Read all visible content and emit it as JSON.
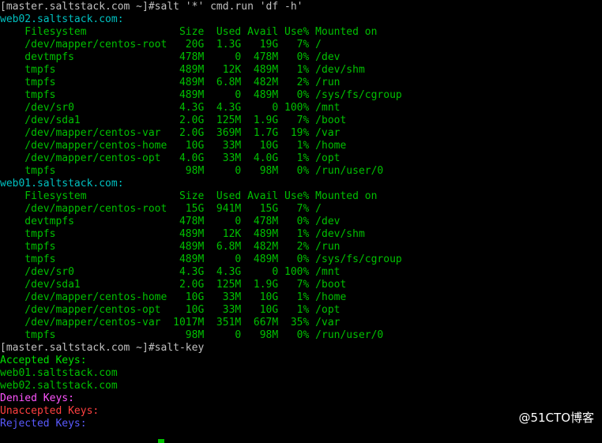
{
  "colors": {
    "background": "#000000",
    "prompt": "#c0c0c0",
    "output": "#00c000",
    "minion_id": "#00c0c0",
    "accepted_header": "#00e000",
    "denied_header": "#ff55ff",
    "unaccepted_header": "#ff4040",
    "rejected_header": "#5a5aff",
    "cursor": "#00c000",
    "watermark": "#ffffff"
  },
  "watermark": "@51CTO博客",
  "lines": [
    {
      "text": "[master.saltstack.com ~]#salt '*' cmd.run 'df -h'",
      "color": "prompt"
    },
    {
      "text": "web02.saltstack.com:",
      "color": "minion_id"
    },
    {
      "text": "    Filesystem               Size  Used Avail Use% Mounted on",
      "color": "output"
    },
    {
      "text": "    /dev/mapper/centos-root   20G  1.3G   19G   7% /",
      "color": "output"
    },
    {
      "text": "    devtmpfs                 478M     0  478M   0% /dev",
      "color": "output"
    },
    {
      "text": "    tmpfs                    489M   12K  489M   1% /dev/shm",
      "color": "output"
    },
    {
      "text": "    tmpfs                    489M  6.8M  482M   2% /run",
      "color": "output"
    },
    {
      "text": "    tmpfs                    489M     0  489M   0% /sys/fs/cgroup",
      "color": "output"
    },
    {
      "text": "    /dev/sr0                 4.3G  4.3G     0 100% /mnt",
      "color": "output"
    },
    {
      "text": "    /dev/sda1                2.0G  125M  1.9G   7% /boot",
      "color": "output"
    },
    {
      "text": "    /dev/mapper/centos-var   2.0G  369M  1.7G  19% /var",
      "color": "output"
    },
    {
      "text": "    /dev/mapper/centos-home   10G   33M   10G   1% /home",
      "color": "output"
    },
    {
      "text": "    /dev/mapper/centos-opt   4.0G   33M  4.0G   1% /opt",
      "color": "output"
    },
    {
      "text": "    tmpfs                     98M     0   98M   0% /run/user/0",
      "color": "output"
    },
    {
      "text": "web01.saltstack.com:",
      "color": "minion_id"
    },
    {
      "text": "    Filesystem               Size  Used Avail Use% Mounted on",
      "color": "output"
    },
    {
      "text": "    /dev/mapper/centos-root   15G  941M   15G   7% /",
      "color": "output"
    },
    {
      "text": "    devtmpfs                 478M     0  478M   0% /dev",
      "color": "output"
    },
    {
      "text": "    tmpfs                    489M   12K  489M   1% /dev/shm",
      "color": "output"
    },
    {
      "text": "    tmpfs                    489M  6.8M  482M   2% /run",
      "color": "output"
    },
    {
      "text": "    tmpfs                    489M     0  489M   0% /sys/fs/cgroup",
      "color": "output"
    },
    {
      "text": "    /dev/sr0                 4.3G  4.3G     0 100% /mnt",
      "color": "output"
    },
    {
      "text": "    /dev/sda1                2.0G  125M  1.9G   7% /boot",
      "color": "output"
    },
    {
      "text": "    /dev/mapper/centos-home   10G   33M   10G   1% /home",
      "color": "output"
    },
    {
      "text": "    /dev/mapper/centos-opt    10G   33M   10G   1% /opt",
      "color": "output"
    },
    {
      "text": "    /dev/mapper/centos-var  1017M  351M  667M  35% /var",
      "color": "output"
    },
    {
      "text": "    tmpfs                     98M     0   98M   0% /run/user/0",
      "color": "output"
    },
    {
      "text": "[master.saltstack.com ~]#salt-key",
      "color": "prompt"
    },
    {
      "text": "Accepted Keys:",
      "color": "accepted_header"
    },
    {
      "text": "web01.saltstack.com",
      "color": "output"
    },
    {
      "text": "web02.saltstack.com",
      "color": "output"
    },
    {
      "text": "Denied Keys:",
      "color": "denied_header"
    },
    {
      "text": "Unaccepted Keys:",
      "color": "unaccepted_header"
    },
    {
      "text": "Rejected Keys:",
      "color": "rejected_header"
    }
  ]
}
